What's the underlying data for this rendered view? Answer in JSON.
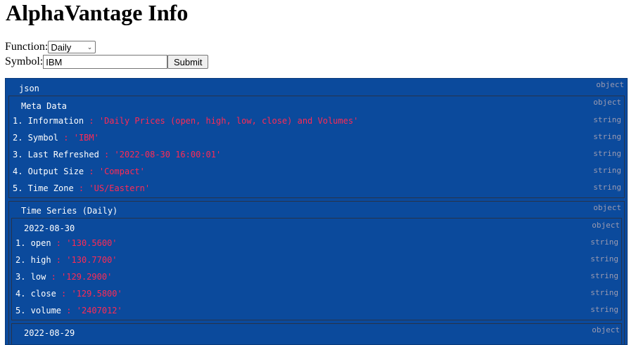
{
  "app": {
    "title": "AlphaVantage Info"
  },
  "form": {
    "function_label": "Function:",
    "function_value": "Daily",
    "symbol_label": "Symbol:",
    "symbol_value": "IBM",
    "submit_label": "Submit"
  },
  "viewer": {
    "root_label": "json",
    "root_type": "object",
    "meta": {
      "label": "Meta Data",
      "type": "object",
      "entries": [
        {
          "key": "1. Information",
          "value": "'Daily Prices (open, high, low, close) and Volumes'",
          "type": "string"
        },
        {
          "key": "2. Symbol",
          "value": "'IBM'",
          "type": "string"
        },
        {
          "key": "3. Last Refreshed",
          "value": "'2022-08-30 16:00:01'",
          "type": "string"
        },
        {
          "key": "4. Output Size",
          "value": "'Compact'",
          "type": "string"
        },
        {
          "key": "5. Time Zone",
          "value": "'US/Eastern'",
          "type": "string"
        }
      ]
    },
    "series": {
      "label": "Time Series (Daily)",
      "type": "object",
      "days": [
        {
          "date": "2022-08-30",
          "type": "object",
          "entries": [
            {
              "key": "1. open",
              "value": "'130.5600'",
              "type": "string"
            },
            {
              "key": "2. high",
              "value": "'130.7700'",
              "type": "string"
            },
            {
              "key": "3. low",
              "value": "'129.2900'",
              "type": "string"
            },
            {
              "key": "4. close",
              "value": "'129.5800'",
              "type": "string"
            },
            {
              "key": "5. volume",
              "value": "'2407012'",
              "type": "string"
            }
          ]
        },
        {
          "date": "2022-08-29",
          "type": "object"
        }
      ]
    }
  },
  "colors": {
    "viewer_bg": "#0b4a9c",
    "key_text": "#ffffff",
    "string_value": "#ff2a55",
    "type_label": "#9a9ab0"
  }
}
